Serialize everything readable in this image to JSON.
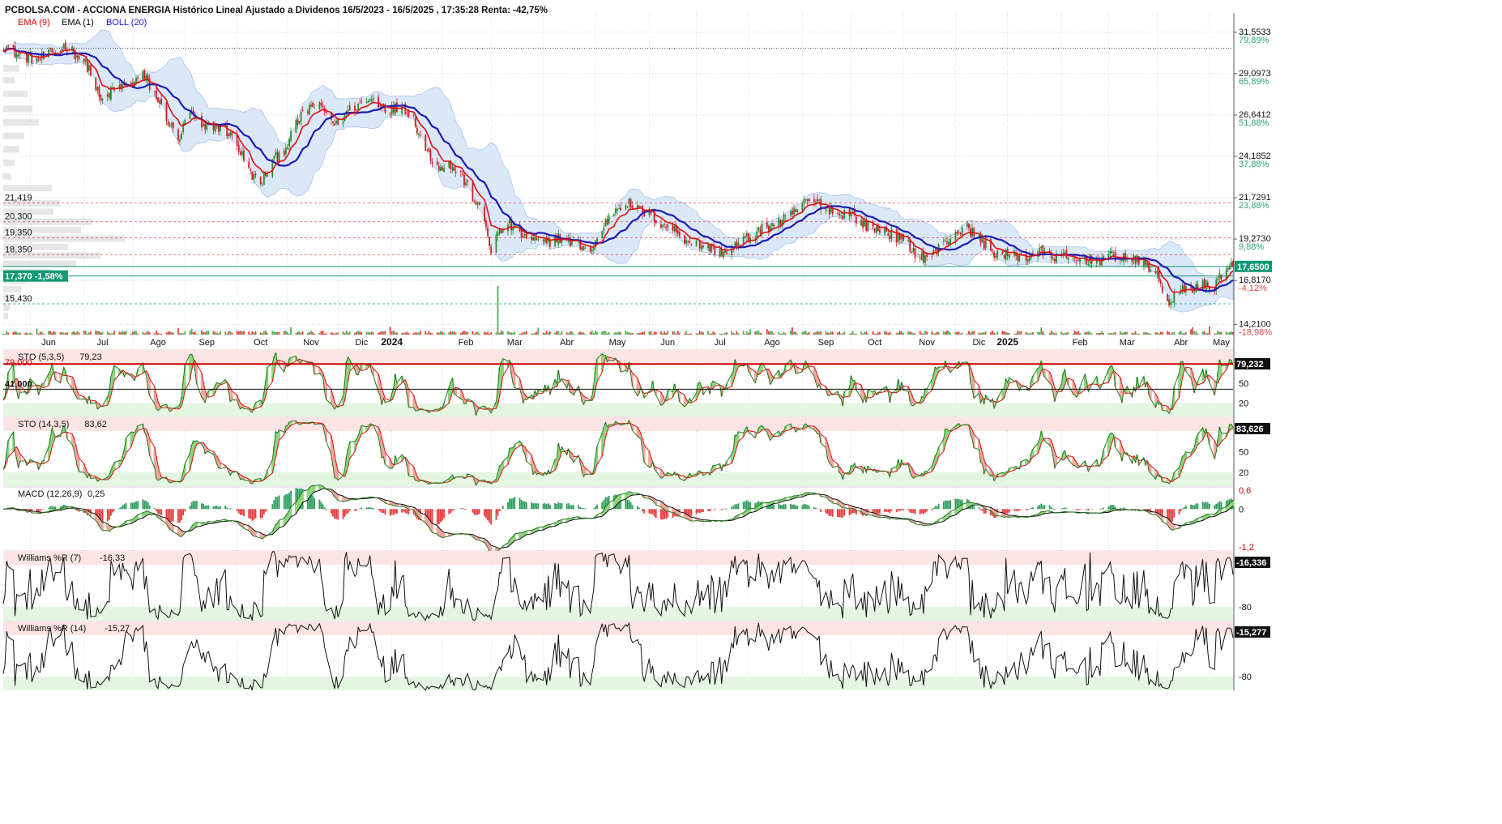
{
  "header": {
    "title": "PCBOLSA.COM - ACCIONA ENERGIA Histórico Lineal Ajustado a Dividenos 16/5/2023 - 16/5/2025 , 17:35:28 Renta: -42,75%",
    "legend": [
      {
        "label": "EMA (9)",
        "color": "#dd0000"
      },
      {
        "label": "EMA (1)",
        "color": "#000000"
      },
      {
        "label": "BOLL (20)",
        "color": "#1a1acc"
      }
    ]
  },
  "colors": {
    "ema9": "#dd1111",
    "boll_mid": "#1c1cb4",
    "boll_band_fill": "#dbe8f8",
    "boll_band_stroke": "#a9c3ea",
    "candle_up": "#2a8a2a",
    "candle_down": "#cc2222",
    "volume_up": "#4caf50",
    "volume_down": "#e04040",
    "osc_up_fill": "#8fd47e",
    "osc_down_fill": "#f2a89e",
    "overbought_zone": "#fde4e4",
    "oversold_zone": "#e4f6e2",
    "price_now_badge": "#0f9a73",
    "current_line": "#0f9a73",
    "grid": "#bdbdbd",
    "level_line": "#e04848",
    "level_line_green": "#0f9a73",
    "pos_pct": "#2aa57a",
    "neg_pct": "#e04848"
  },
  "chart_data": [
    {
      "type": "candlestick",
      "id": "price",
      "x_axis": {
        "start": "2023-05-16",
        "end": "2025-05-16",
        "tick_labels": [
          "Jun",
          "Jul",
          "Ago",
          "Sep",
          "Oct",
          "Nov",
          "Dic",
          "2024",
          "Feb",
          "Mar",
          "Abr",
          "May",
          "Jun",
          "Jul",
          "Ago",
          "Sep",
          "Oct",
          "Nov",
          "Dic",
          "2025",
          "Feb",
          "Mar",
          "Abr",
          "May"
        ],
        "bold_labels": [
          "2024",
          "2025"
        ]
      },
      "ylim": [
        13.6,
        32.7
      ],
      "right_axis": [
        {
          "value": "31,5533",
          "pct": "79,89%"
        },
        {
          "value": "29,0973",
          "pct": "65,89%"
        },
        {
          "value": "26,6412",
          "pct": "51,88%"
        },
        {
          "value": "24,1852",
          "pct": "37,88%"
        },
        {
          "value": "21,7291",
          "pct": "23,88%"
        },
        {
          "value": "19,2730",
          "pct": "9,88%"
        },
        {
          "value": "16,8170",
          "pct": "-4,12%"
        },
        {
          "value": "14,2100",
          "pct": "-18,98%"
        }
      ],
      "right_axis_values": [
        31.5533,
        29.0973,
        26.6412,
        24.1852,
        21.7291,
        19.273,
        16.817,
        14.21
      ],
      "current_price": {
        "label": "17,6500",
        "value": 17.65
      },
      "left_levels": [
        {
          "label": "21,419",
          "value": 21.419
        },
        {
          "label": "20,300",
          "value": 20.3
        },
        {
          "label": "19,350",
          "value": 19.35
        },
        {
          "label": "18,350",
          "value": 18.35
        },
        {
          "label": "15,430",
          "value": 15.43
        }
      ],
      "left_badge": {
        "label": "17,370  -1,58%",
        "value": 17.37
      },
      "dotted_high_line": 30.6,
      "price_path": [
        [
          "2023-05-16",
          30.8
        ],
        [
          "2023-05-25",
          30.2
        ],
        [
          "2023-06-05",
          29.9
        ],
        [
          "2023-06-15",
          30.3
        ],
        [
          "2023-06-22",
          30.8
        ],
        [
          "2023-06-29",
          30.2
        ],
        [
          "2023-07-06",
          29.4
        ],
        [
          "2023-07-13",
          27.4
        ],
        [
          "2023-07-20",
          28.1
        ],
        [
          "2023-07-31",
          28.5
        ],
        [
          "2023-08-07",
          29.0
        ],
        [
          "2023-08-14",
          27.9
        ],
        [
          "2023-08-21",
          26.5
        ],
        [
          "2023-08-28",
          25.1
        ],
        [
          "2023-09-04",
          26.9
        ],
        [
          "2023-09-11",
          25.8
        ],
        [
          "2023-09-18",
          26.0
        ],
        [
          "2023-09-25",
          25.8
        ],
        [
          "2023-10-02",
          24.9
        ],
        [
          "2023-10-09",
          23.3
        ],
        [
          "2023-10-16",
          22.5
        ],
        [
          "2023-10-23",
          23.9
        ],
        [
          "2023-10-30",
          24.6
        ],
        [
          "2023-11-08",
          26.4
        ],
        [
          "2023-11-15",
          27.2
        ],
        [
          "2023-11-22",
          27.0
        ],
        [
          "2023-11-30",
          26.0
        ],
        [
          "2023-12-07",
          26.9
        ],
        [
          "2023-12-14",
          27.3
        ],
        [
          "2023-12-21",
          27.6
        ],
        [
          "2024-01-02",
          26.9
        ],
        [
          "2024-01-08",
          27.3
        ],
        [
          "2024-01-15",
          26.4
        ],
        [
          "2024-01-22",
          24.6
        ],
        [
          "2024-01-29",
          23.6
        ],
        [
          "2024-02-05",
          23.7
        ],
        [
          "2024-02-12",
          23.1
        ],
        [
          "2024-02-19",
          21.8
        ],
        [
          "2024-02-26",
          20.4
        ],
        [
          "2024-03-01",
          18.6
        ],
        [
          "2024-03-04",
          19.4
        ],
        [
          "2024-03-11",
          20.2
        ],
        [
          "2024-03-18",
          19.6
        ],
        [
          "2024-03-25",
          19.2
        ],
        [
          "2024-04-02",
          19.0
        ],
        [
          "2024-04-09",
          19.4
        ],
        [
          "2024-04-16",
          19.1
        ],
        [
          "2024-04-23",
          18.9
        ],
        [
          "2024-04-30",
          18.6
        ],
        [
          "2024-05-06",
          19.9
        ],
        [
          "2024-05-13",
          21.0
        ],
        [
          "2024-05-20",
          21.5
        ],
        [
          "2024-05-27",
          21.0
        ],
        [
          "2024-06-03",
          20.8
        ],
        [
          "2024-06-10",
          20.2
        ],
        [
          "2024-06-17",
          19.9
        ],
        [
          "2024-06-24",
          19.3
        ],
        [
          "2024-07-01",
          19.0
        ],
        [
          "2024-07-08",
          18.8
        ],
        [
          "2024-07-15",
          18.5
        ],
        [
          "2024-07-22",
          18.7
        ],
        [
          "2024-07-29",
          19.2
        ],
        [
          "2024-08-05",
          19.6
        ],
        [
          "2024-08-12",
          20.0
        ],
        [
          "2024-08-19",
          20.3
        ],
        [
          "2024-08-26",
          20.6
        ],
        [
          "2024-09-02",
          21.4
        ],
        [
          "2024-09-09",
          21.5
        ],
        [
          "2024-09-16",
          21.2
        ],
        [
          "2024-09-23",
          20.7
        ],
        [
          "2024-09-30",
          20.9
        ],
        [
          "2024-10-07",
          20.2
        ],
        [
          "2024-10-14",
          19.9
        ],
        [
          "2024-10-21",
          19.8
        ],
        [
          "2024-10-28",
          19.4
        ],
        [
          "2024-11-04",
          18.9
        ],
        [
          "2024-11-11",
          18.2
        ],
        [
          "2024-11-18",
          18.3
        ],
        [
          "2024-11-25",
          19.0
        ],
        [
          "2024-12-02",
          19.7
        ],
        [
          "2024-12-09",
          19.9
        ],
        [
          "2024-12-16",
          19.3
        ],
        [
          "2024-12-23",
          18.6
        ],
        [
          "2024-12-30",
          18.3
        ],
        [
          "2025-01-06",
          18.3
        ],
        [
          "2025-01-13",
          18.2
        ],
        [
          "2025-01-20",
          18.6
        ],
        [
          "2025-01-27",
          18.3
        ],
        [
          "2025-02-03",
          18.2
        ],
        [
          "2025-02-10",
          18.0
        ],
        [
          "2025-02-17",
          18.1
        ],
        [
          "2025-02-24",
          18.0
        ],
        [
          "2025-03-03",
          18.2
        ],
        [
          "2025-03-10",
          18.3
        ],
        [
          "2025-03-17",
          18.0
        ],
        [
          "2025-03-24",
          17.9
        ],
        [
          "2025-03-31",
          17.3
        ],
        [
          "2025-04-07",
          15.5
        ],
        [
          "2025-04-14",
          16.1
        ],
        [
          "2025-04-21",
          16.4
        ],
        [
          "2025-04-28",
          16.5
        ],
        [
          "2025-05-05",
          16.5
        ],
        [
          "2025-05-12",
          17.7
        ],
        [
          "2025-05-16",
          17.65
        ]
      ]
    },
    {
      "type": "line",
      "id": "sto_5",
      "label": "STO (5,3,5)",
      "value_label": "79,23",
      "last_value": 79.232,
      "last_badge": "79,232",
      "ylim": [
        0,
        100
      ],
      "axis_labels": [
        "50",
        "20"
      ],
      "level_tag": "79,000",
      "upper_level": 79.0,
      "lower_level": 41.0,
      "lower_tag": "41,000"
    },
    {
      "type": "line",
      "id": "sto_14",
      "label": "STO (14,3,5)",
      "value_label": "83,62",
      "last_value": 83.626,
      "last_badge": "83,626",
      "ylim": [
        0,
        100
      ],
      "axis_labels": [
        "50",
        "20"
      ]
    },
    {
      "type": "line",
      "id": "macd",
      "label": "MACD (12,26,9)",
      "value_label": "0,25",
      "ylim": [
        -1.3,
        0.7
      ],
      "axis_labels": [
        "0,6",
        "0",
        "-1,2"
      ]
    },
    {
      "type": "line",
      "id": "williams_7",
      "label": "Williams %R (7)",
      "value_label": "-16,33",
      "last_value": -16.336,
      "last_badge": "-16,336",
      "ylim": [
        -100,
        0
      ],
      "axis_labels": [
        "-80"
      ]
    },
    {
      "type": "line",
      "id": "williams_14",
      "label": "Williams %R (14)",
      "value_label": "-15,27",
      "last_value": -15.277,
      "last_badge": "-15,277",
      "ylim": [
        -100,
        0
      ],
      "axis_labels": [
        "-80"
      ]
    }
  ]
}
